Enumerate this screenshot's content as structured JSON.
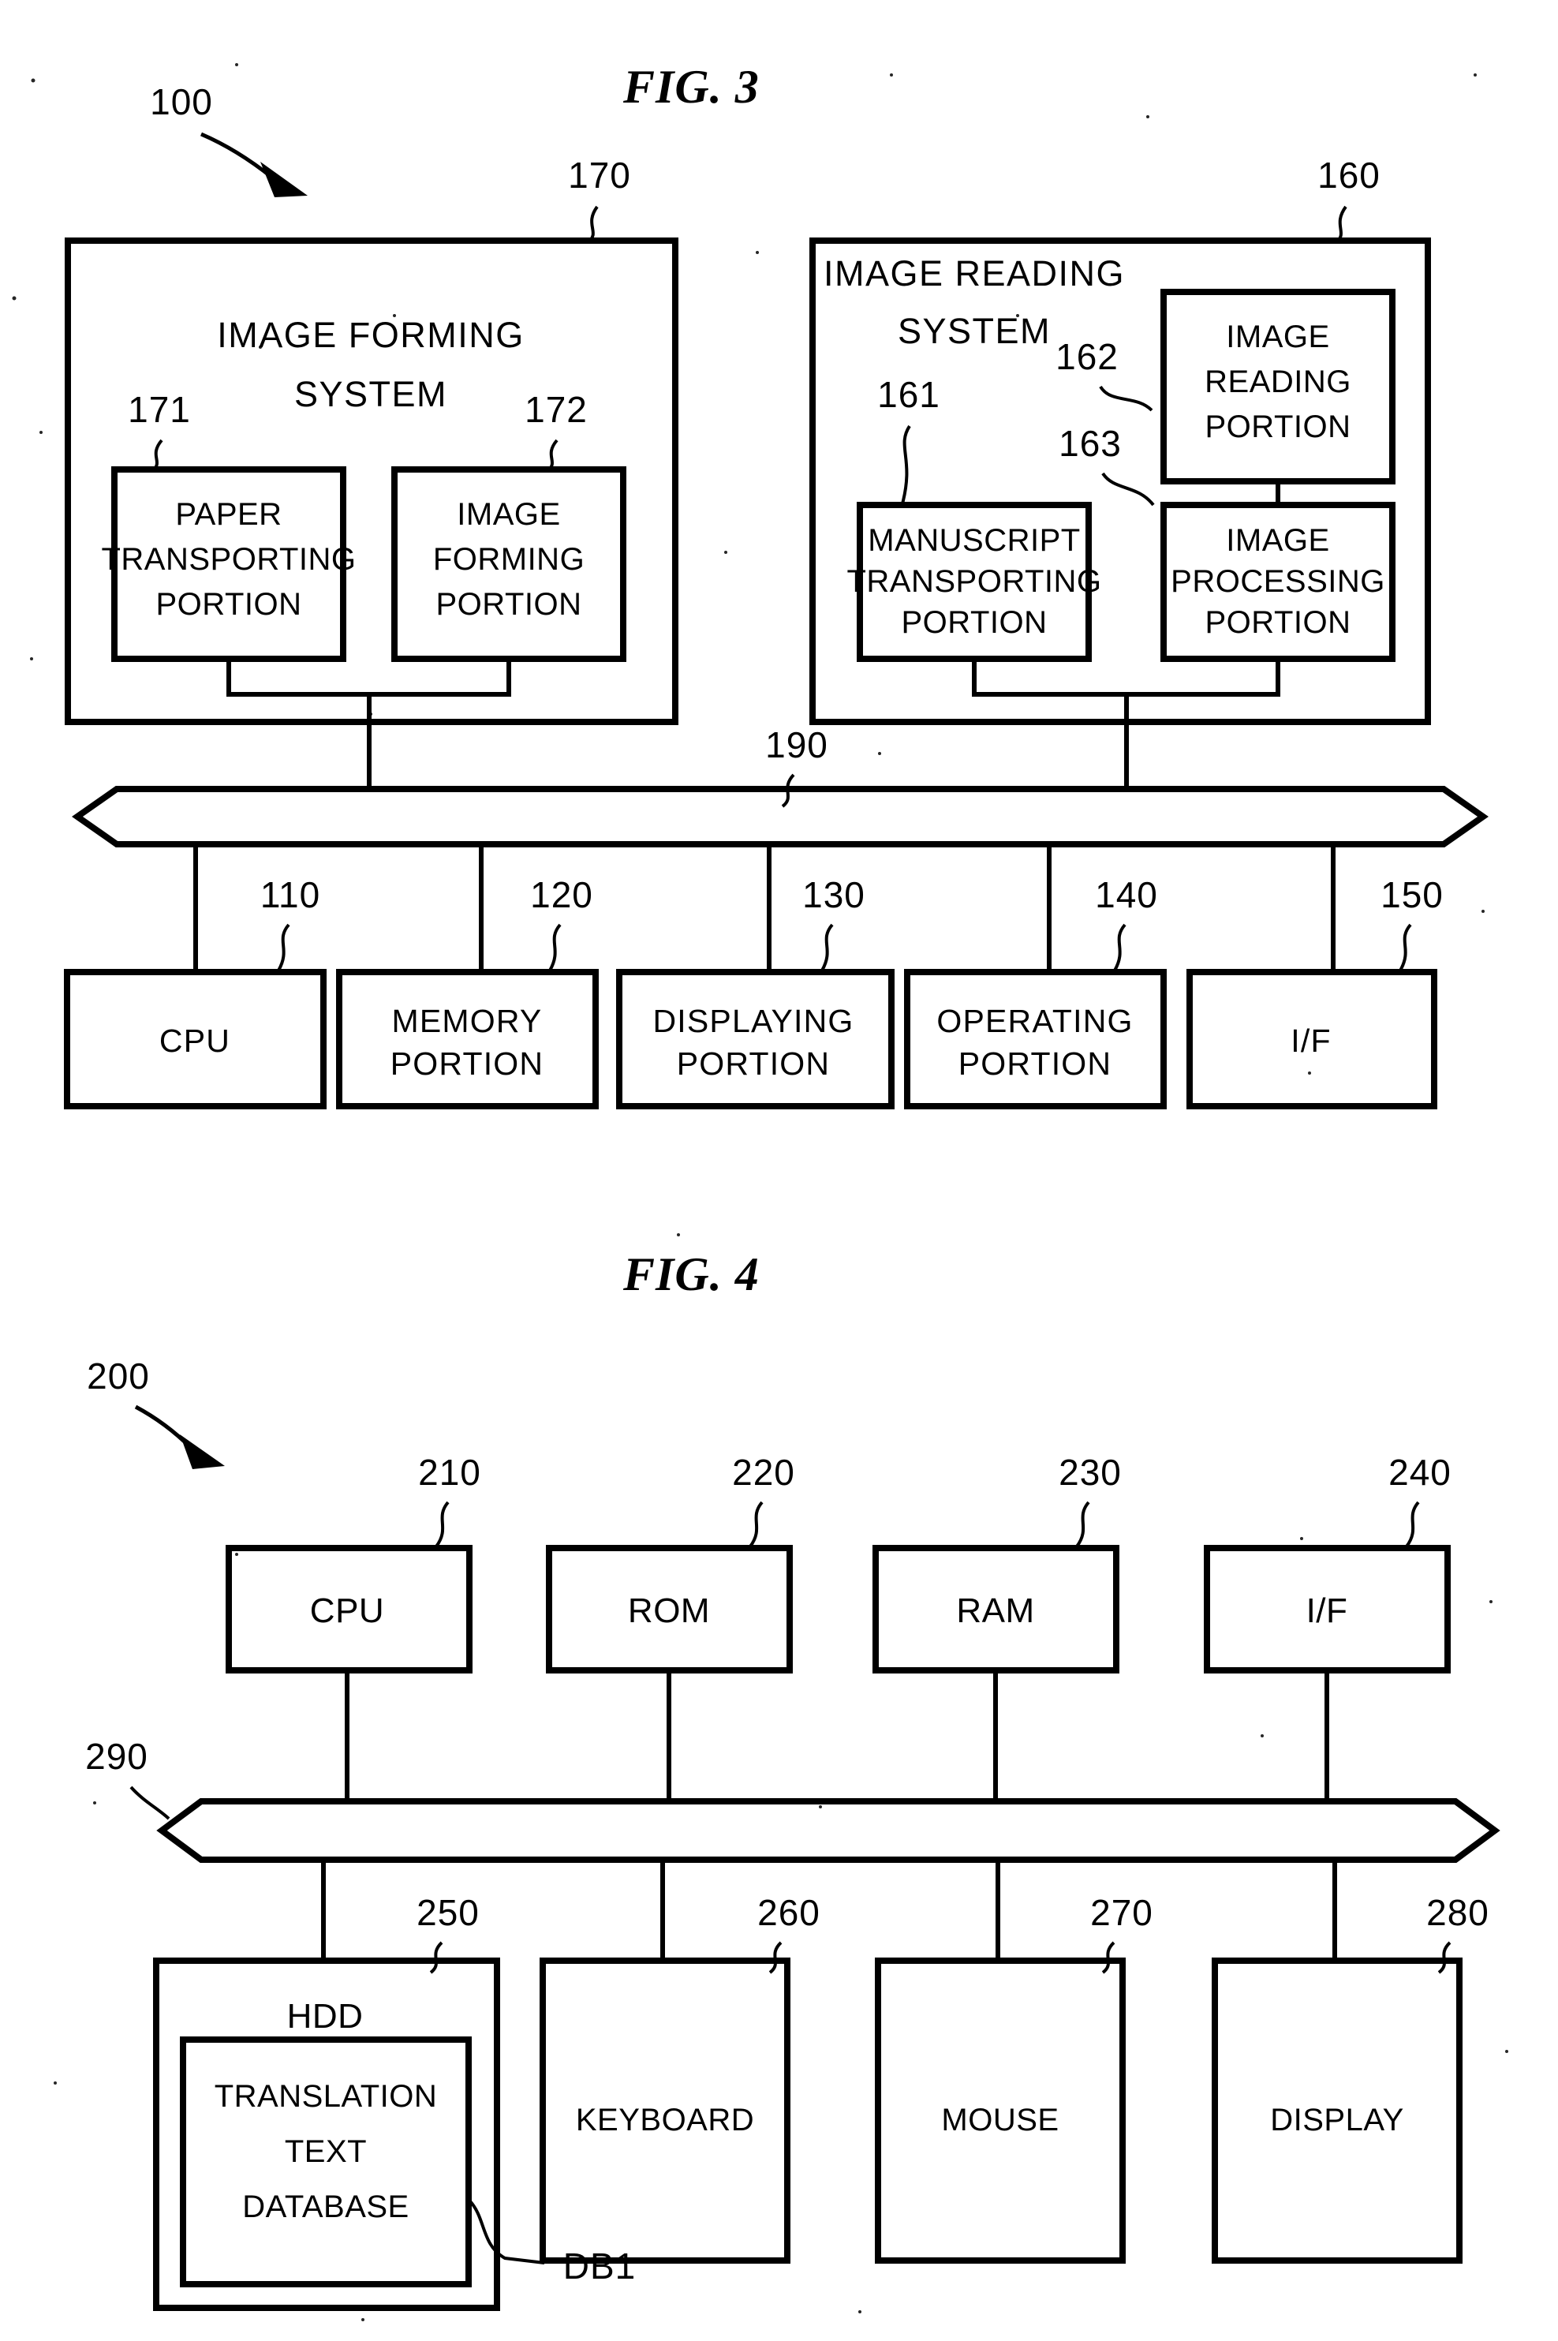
{
  "figures": [
    {
      "id": "fig3",
      "title": "FIG. 3",
      "system_ref": "100",
      "bus_ref": "190",
      "blocks": {
        "image_forming_system": {
          "ref": "170",
          "label_line1": "IMAGE FORMING",
          "label_line2": "SYSTEM",
          "children": [
            {
              "ref": "171",
              "label_line1": "PAPER",
              "label_line2": "TRANSPORTING",
              "label_line3": "PORTION"
            },
            {
              "ref": "172",
              "label_line1": "IMAGE",
              "label_line2": "FORMING",
              "label_line3": "PORTION"
            }
          ]
        },
        "image_reading_system": {
          "ref": "160",
          "label_line1": "IMAGE READING",
          "label_line2": "SYSTEM",
          "children": [
            {
              "ref": "162",
              "label_line1": "IMAGE",
              "label_line2": "READING",
              "label_line3": "PORTION"
            },
            {
              "ref": "161",
              "label_line1": "MANUSCRIPT",
              "label_line2": "TRANSPORTING",
              "label_line3": "PORTION"
            },
            {
              "ref": "163",
              "label_line1": "IMAGE",
              "label_line2": "PROCESSING",
              "label_line3": "PORTION"
            }
          ]
        }
      },
      "bus_devices": [
        {
          "ref": "110",
          "label_line1": "CPU",
          "label_line2": ""
        },
        {
          "ref": "120",
          "label_line1": "MEMORY",
          "label_line2": "PORTION"
        },
        {
          "ref": "130",
          "label_line1": "DISPLAYING",
          "label_line2": "PORTION"
        },
        {
          "ref": "140",
          "label_line1": "OPERATING",
          "label_line2": "PORTION"
        },
        {
          "ref": "150",
          "label_line1": "I/F",
          "label_line2": ""
        }
      ]
    },
    {
      "id": "fig4",
      "title": "FIG. 4",
      "system_ref": "200",
      "bus_ref": "290",
      "top_devices": [
        {
          "ref": "210",
          "label": "CPU"
        },
        {
          "ref": "220",
          "label": "ROM"
        },
        {
          "ref": "230",
          "label": "RAM"
        },
        {
          "ref": "240",
          "label": "I/F"
        }
      ],
      "bottom_devices": [
        {
          "ref": "250",
          "label": "HDD",
          "nested": {
            "ref": "DB1",
            "label_line1": "TRANSLATION",
            "label_line2": "TEXT",
            "label_line3": "DATABASE"
          }
        },
        {
          "ref": "260",
          "label": "KEYBOARD"
        },
        {
          "ref": "270",
          "label": "MOUSE"
        },
        {
          "ref": "280",
          "label": "DISPLAY"
        }
      ]
    }
  ],
  "colors": {
    "ink": "#000000",
    "paper": "#ffffff"
  }
}
